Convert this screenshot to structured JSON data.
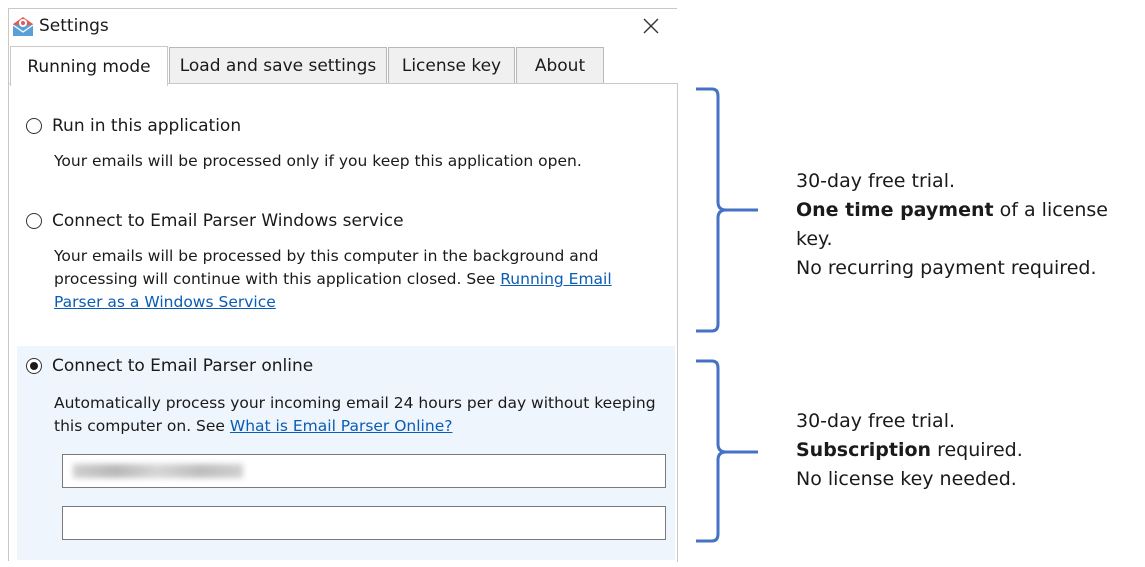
{
  "window": {
    "title": "Settings",
    "close_symbol": "✕"
  },
  "tabs": [
    {
      "label": "Running mode",
      "active": true
    },
    {
      "label": "Load and save settings",
      "active": false
    },
    {
      "label": "License key",
      "active": false
    },
    {
      "label": "About",
      "active": false
    }
  ],
  "options": {
    "app": {
      "label": "Run in this application",
      "description": "Your emails will be processed only if you keep this application open.",
      "selected": false
    },
    "service": {
      "label": "Connect to Email Parser Windows service",
      "description": "Your emails will be processed by this computer in the background and processing will continue with this application closed. See",
      "link": "Running Email Parser as a Windows Service",
      "selected": false
    },
    "online": {
      "label": "Connect to Email Parser online",
      "description": "Automatically process your incoming email 24 hours per day without keeping this computer on. See",
      "link": "What is Email Parser Online?",
      "selected": true,
      "email_value": "",
      "password_value": ""
    }
  },
  "notes": {
    "top": {
      "line1": "30-day free trial.",
      "line2_bold": "One time payment",
      "line2_rest": " of a license key.",
      "line3": "No recurring payment required."
    },
    "bottom": {
      "line1": "30-day free trial.",
      "line2_bold": "Subscription",
      "line2_rest": " required.",
      "line3": "No license key needed."
    }
  },
  "colors": {
    "accent_brace": "#4472c4",
    "link": "#0b5cb5",
    "online_bg": "#eef5fc"
  }
}
